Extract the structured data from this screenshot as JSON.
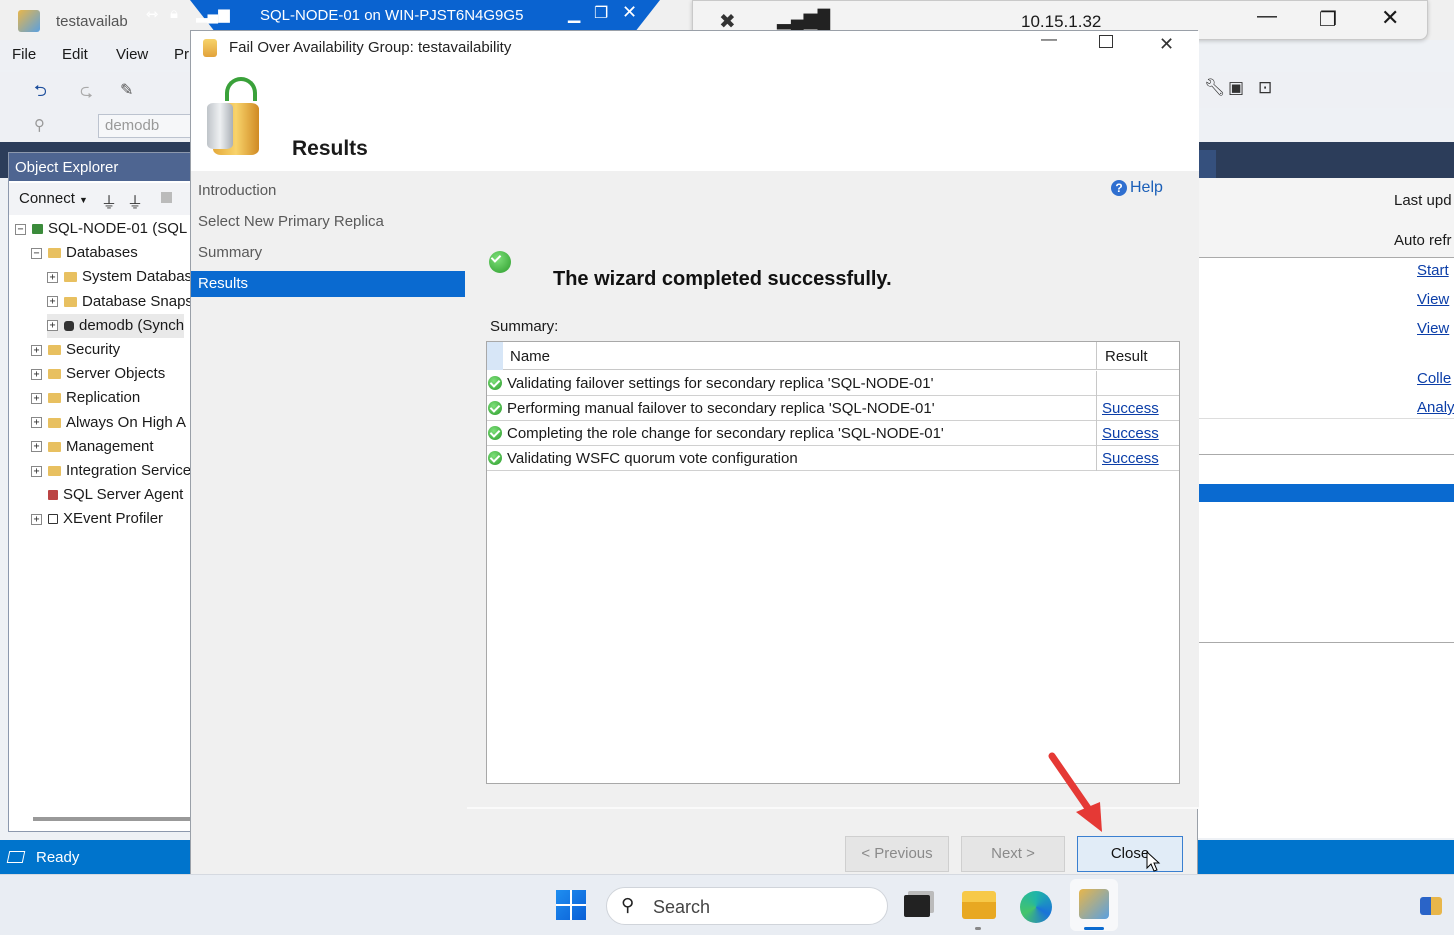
{
  "ssms": {
    "title": "testavailab",
    "menu": [
      "File",
      "Edit",
      "View",
      "Pr"
    ],
    "db_combo": "demodb",
    "status": "Ready"
  },
  "remote_bar": {
    "title": "SQL-NODE-01 on WIN-PJST6N4G9G5"
  },
  "rdp": {
    "ip": "10.15.1.32"
  },
  "object_explorer": {
    "title": "Object Explorer",
    "connect_label": "Connect",
    "tree": [
      {
        "label": "SQL-NODE-01 (SQL :",
        "expander": "−",
        "level": 0,
        "kind": "server"
      },
      {
        "label": "Databases",
        "expander": "−",
        "level": 1,
        "kind": "folder"
      },
      {
        "label": "System Databas",
        "expander": "+",
        "level": 2,
        "kind": "folder"
      },
      {
        "label": "Database Snaps",
        "expander": "+",
        "level": 2,
        "kind": "folder"
      },
      {
        "label": "demodb (Synch",
        "expander": "+",
        "level": 2,
        "kind": "db"
      },
      {
        "label": "Security",
        "expander": "+",
        "level": 1,
        "kind": "folder"
      },
      {
        "label": "Server Objects",
        "expander": "+",
        "level": 1,
        "kind": "folder"
      },
      {
        "label": "Replication",
        "expander": "+",
        "level": 1,
        "kind": "folder"
      },
      {
        "label": "Always On High A",
        "expander": "+",
        "level": 1,
        "kind": "folder"
      },
      {
        "label": "Management",
        "expander": "+",
        "level": 1,
        "kind": "folder"
      },
      {
        "label": "Integration Service",
        "expander": "+",
        "level": 1,
        "kind": "folder"
      },
      {
        "label": "SQL Server Agent",
        "expander": "",
        "level": 1,
        "kind": "agent"
      },
      {
        "label": "XEvent Profiler",
        "expander": "+",
        "level": 1,
        "kind": "xevent"
      }
    ]
  },
  "right_pane": {
    "last_updated": "Last upd",
    "auto_refresh": "Auto refr",
    "links": [
      "Start",
      "View",
      "View",
      "Colle",
      "Analy"
    ]
  },
  "dialog": {
    "title": "Fail Over Availability Group: testavailability",
    "header": "Results",
    "nav": [
      "Introduction",
      "Select New Primary Replica",
      "Summary",
      "Results"
    ],
    "selected_nav": "Results",
    "help_label": "Help",
    "success_message": "The wizard completed successfully.",
    "summary_label": "Summary:",
    "columns": [
      "Name",
      "Result"
    ],
    "rows": [
      {
        "name": "Validating failover settings for secondary replica 'SQL-NODE-01'",
        "result": ""
      },
      {
        "name": "Performing manual failover to secondary replica 'SQL-NODE-01'",
        "result": "Success"
      },
      {
        "name": "Completing the role change for secondary replica 'SQL-NODE-01'",
        "result": "Success"
      },
      {
        "name": "Validating WSFC quorum vote configuration",
        "result": "Success"
      }
    ],
    "buttons": {
      "previous": "< Previous",
      "next": "Next >",
      "close": "Close"
    }
  },
  "taskbar": {
    "search_placeholder": "Search"
  }
}
